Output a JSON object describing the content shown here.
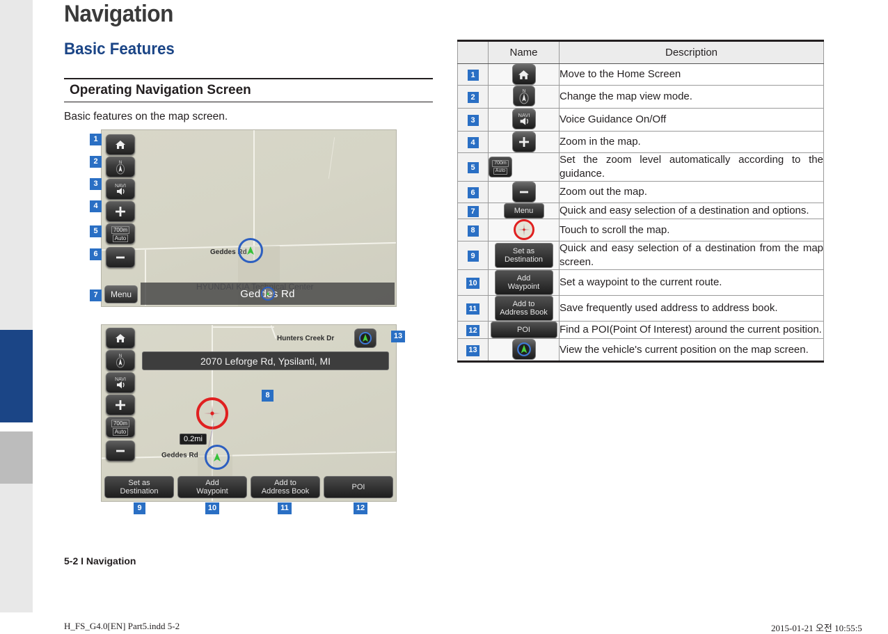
{
  "page": {
    "chapter_title": "Navigation",
    "section_title": "Basic Features",
    "subhead": "Operating Navigation Screen",
    "intro": "Basic features on the map screen.",
    "page_footer": "5-2 I Navigation",
    "print_footer_left": "H_FS_G4.0[EN] Part5.indd   5-2",
    "print_footer_right": "2015-01-21   오전 10:55:5",
    "accent_blue": "#1b4586",
    "badge_blue": "#2a6fc4"
  },
  "figure1": {
    "buttons": {
      "home": "home-icon",
      "map_view": "compass-icon",
      "voice": "NAVI",
      "zoom_in": "+",
      "zoom_level_top": "700m",
      "zoom_level_bottom": "Auto",
      "zoom_out": "−",
      "menu": "Menu"
    },
    "map_labels": {
      "road": "Geddes Rd",
      "poi": "HYUNDAI KIA Technical Center",
      "status_bar": "Geddes Rd"
    },
    "callouts": [
      "1",
      "2",
      "3",
      "4",
      "5",
      "6",
      "7"
    ]
  },
  "figure2": {
    "address_bar": "2070 Leforge Rd, Ypsilanti, MI",
    "map_labels": {
      "road_top": "Hunters Creek Dr",
      "road_bottom": "Geddes Rd",
      "distance": "0.2mi"
    },
    "action_buttons": [
      "Set as\nDestination",
      "Add\nWaypoint",
      "Add to\nAddress Book",
      "POI"
    ],
    "callouts": [
      "8",
      "9",
      "10",
      "11",
      "12",
      "13"
    ]
  },
  "table": {
    "headers": [
      "",
      "Name",
      "Description"
    ],
    "rows": [
      {
        "num": "1",
        "icon": "home-icon",
        "icon_text": "",
        "desc": "Move to the Home Screen"
      },
      {
        "num": "2",
        "icon": "compass-icon",
        "icon_text": "N",
        "desc": "Change the map view mode."
      },
      {
        "num": "3",
        "icon": "speaker-icon",
        "icon_text": "NAVI",
        "desc": "Voice Guidance On/Off"
      },
      {
        "num": "4",
        "icon": "plus-icon",
        "icon_text": "+",
        "desc": "Zoom in the map."
      },
      {
        "num": "5",
        "icon": "zoom-level-icon",
        "icon_text": "700m / Auto",
        "desc": "Set the zoom level automatically according to the guidance."
      },
      {
        "num": "6",
        "icon": "minus-icon",
        "icon_text": "−",
        "desc": "Zoom out the map."
      },
      {
        "num": "7",
        "icon": "menu-button",
        "icon_text": "Menu",
        "desc": "Quick and easy selection of a destination and options."
      },
      {
        "num": "8",
        "icon": "crosshair-icon",
        "icon_text": "",
        "desc": "Touch to scroll the map."
      },
      {
        "num": "9",
        "icon": "set-as-destination-button",
        "icon_text": "Set as\nDestination",
        "desc": "Quick and easy selection of a destination from the map screen."
      },
      {
        "num": "10",
        "icon": "add-waypoint-button",
        "icon_text": "Add\nWaypoint",
        "desc": "Set a waypoint to the current route."
      },
      {
        "num": "11",
        "icon": "add-to-address-book-button",
        "icon_text": "Add to\nAddress Book",
        "desc": "Save frequently used address to address book."
      },
      {
        "num": "12",
        "icon": "poi-button",
        "icon_text": "POI",
        "desc": "Find a POI(Point Of Interest) around the current position."
      },
      {
        "num": "13",
        "icon": "current-position-icon",
        "icon_text": "",
        "desc": "View the vehicle's current position on the map screen."
      }
    ]
  }
}
